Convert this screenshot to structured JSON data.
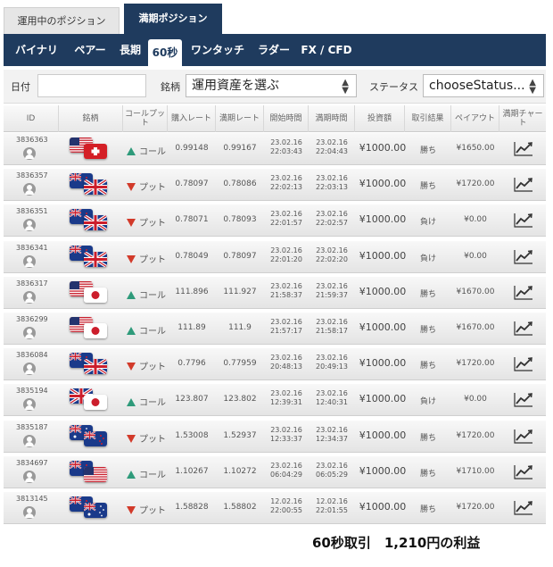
{
  "top_tabs": [
    "運用中のポジション",
    "満期ポジション"
  ],
  "nav": [
    "バイナリ",
    "ペアー",
    "長期",
    "60秒",
    "ワンタッチ",
    "ラダー",
    "FX / CFD"
  ],
  "filter": {
    "date_label": "日付",
    "asset_label": "銘柄",
    "asset_value": "運用資産を選ぶ",
    "status_label": "ステータス",
    "status_value": "chooseStatus..."
  },
  "headers": {
    "id": "ID",
    "asset": "銘柄",
    "callput": "コールプット",
    "buy_rate": "購入レート",
    "expiry_rate": "満期レート",
    "start": "開始時間",
    "expiry": "満期時間",
    "amount": "投資額",
    "result": "取引結果",
    "payout": "ペイアウト",
    "chart": "満期チャート"
  },
  "rows": [
    {
      "id": "3836363",
      "flag1": "us",
      "flag2": "ch",
      "dir": "コール",
      "buy": "0.99148",
      "exp": "0.99167",
      "start_d": "23.02.16",
      "start_t": "22:03:43",
      "end_d": "23.02.16",
      "end_t": "22:04:43",
      "amount": "¥1000.00",
      "result": "勝ち",
      "payout": "¥1650.00"
    },
    {
      "id": "3836357",
      "flag1": "nz",
      "flag2": "gb",
      "dir": "プット",
      "buy": "0.78097",
      "exp": "0.78086",
      "start_d": "23.02.16",
      "start_t": "22:02:13",
      "end_d": "23.02.16",
      "end_t": "22:03:13",
      "amount": "¥1000.00",
      "result": "勝ち",
      "payout": "¥1720.00"
    },
    {
      "id": "3836351",
      "flag1": "nz",
      "flag2": "gb",
      "dir": "プット",
      "buy": "0.78071",
      "exp": "0.78093",
      "start_d": "23.02.16",
      "start_t": "22:01:57",
      "end_d": "23.02.16",
      "end_t": "22:02:57",
      "amount": "¥1000.00",
      "result": "負け",
      "payout": "¥0.00"
    },
    {
      "id": "3836341",
      "flag1": "nz",
      "flag2": "gb",
      "dir": "プット",
      "buy": "0.78049",
      "exp": "0.78097",
      "start_d": "23.02.16",
      "start_t": "22:01:20",
      "end_d": "23.02.16",
      "end_t": "22:02:20",
      "amount": "¥1000.00",
      "result": "負け",
      "payout": "¥0.00"
    },
    {
      "id": "3836317",
      "flag1": "us",
      "flag2": "jp",
      "dir": "コール",
      "buy": "111.896",
      "exp": "111.927",
      "start_d": "23.02.16",
      "start_t": "21:58:37",
      "end_d": "23.02.16",
      "end_t": "21:59:37",
      "amount": "¥1000.00",
      "result": "勝ち",
      "payout": "¥1670.00"
    },
    {
      "id": "3836299",
      "flag1": "us",
      "flag2": "jp",
      "dir": "コール",
      "buy": "111.89",
      "exp": "111.9",
      "start_d": "23.02.16",
      "start_t": "21:57:17",
      "end_d": "23.02.16",
      "end_t": "21:58:17",
      "amount": "¥1000.00",
      "result": "勝ち",
      "payout": "¥1670.00"
    },
    {
      "id": "3836084",
      "flag1": "nz",
      "flag2": "gb",
      "dir": "プット",
      "buy": "0.7796",
      "exp": "0.77959",
      "start_d": "23.02.16",
      "start_t": "20:48:13",
      "end_d": "23.02.16",
      "end_t": "20:49:13",
      "amount": "¥1000.00",
      "result": "勝ち",
      "payout": "¥1720.00"
    },
    {
      "id": "3835194",
      "flag1": "gb",
      "flag2": "jp",
      "dir": "コール",
      "buy": "123.807",
      "exp": "123.802",
      "start_d": "23.02.16",
      "start_t": "12:39:31",
      "end_d": "23.02.16",
      "end_t": "12:40:31",
      "amount": "¥1000.00",
      "result": "負け",
      "payout": "¥0.00"
    },
    {
      "id": "3835187",
      "flag1": "au",
      "flag2": "nz",
      "dir": "プット",
      "buy": "1.53008",
      "exp": "1.52937",
      "start_d": "23.02.16",
      "start_t": "12:33:37",
      "end_d": "23.02.16",
      "end_t": "12:34:37",
      "amount": "¥1000.00",
      "result": "勝ち",
      "payout": "¥1720.00"
    },
    {
      "id": "3834697",
      "flag1": "nz",
      "flag2": "us",
      "dir": "コール",
      "buy": "1.10267",
      "exp": "1.10272",
      "start_d": "23.02.16",
      "start_t": "06:04:29",
      "end_d": "23.02.16",
      "end_t": "06:05:29",
      "amount": "¥1000.00",
      "result": "勝ち",
      "payout": "¥1710.00"
    },
    {
      "id": "3813145",
      "flag1": "nz",
      "flag2": "au",
      "dir": "プット",
      "buy": "1.58828",
      "exp": "1.58802",
      "start_d": "12.02.16",
      "start_t": "22:00:55",
      "end_d": "12.02.16",
      "end_t": "22:01:55",
      "amount": "¥1000.00",
      "result": "勝ち",
      "payout": "¥1720.00"
    }
  ],
  "summary": "60秒取引　1,210円の利益"
}
